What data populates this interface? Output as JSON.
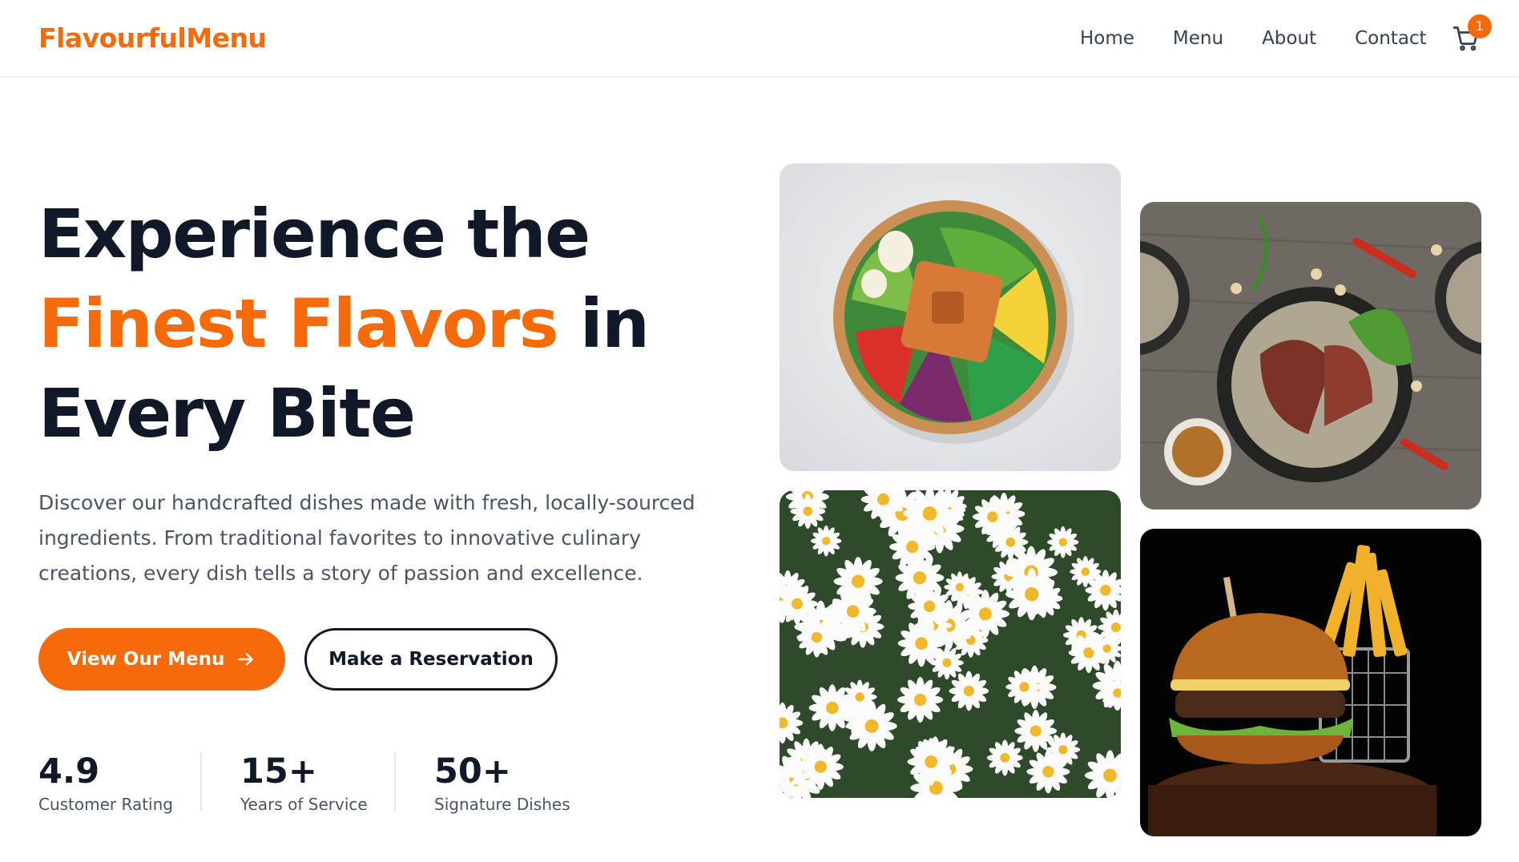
{
  "header": {
    "logo": "FlavourfulMenu",
    "nav": [
      "Home",
      "Menu",
      "About",
      "Contact"
    ],
    "cart_count": "1",
    "cart_icon": "cart-icon"
  },
  "hero": {
    "title_line1": "Experience the",
    "title_accent": "Finest Flavors",
    "title_in": " in",
    "title_line3": "Every Bite",
    "description": "Discover our handcrafted dishes made with fresh, locally-sourced ingredients. From traditional favorites to innovative culinary creations, every dish tells a story of passion and excellence.",
    "primary_button": "View Our Menu",
    "primary_button_icon": "arrow-right-icon",
    "secondary_button": "Make a Reservation"
  },
  "stats": [
    {
      "value": "4.9",
      "label": "Customer Rating"
    },
    {
      "value": "15+",
      "label": "Years of Service"
    },
    {
      "value": "50+",
      "label": "Signature Dishes"
    }
  ],
  "gallery": [
    "salad-bowl-image",
    "steak-plates-image",
    "daisy-flowers-image",
    "burger-fries-image"
  ],
  "colors": {
    "accent": "#f56a0a",
    "text": "#111827",
    "muted": "#4b5563"
  }
}
